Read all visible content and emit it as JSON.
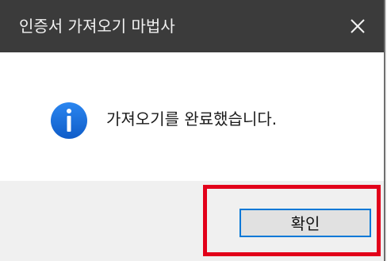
{
  "window": {
    "title": "인증서 가져오기 마법사",
    "close_icon": "close-icon"
  },
  "dialog": {
    "icon": "info-icon",
    "icon_color": "#1e6fd9",
    "message": "가져오기를 완료했습니다."
  },
  "footer": {
    "ok_label": "확인",
    "highlight_color": "#e2001a",
    "focus_color": "#0078d7"
  }
}
